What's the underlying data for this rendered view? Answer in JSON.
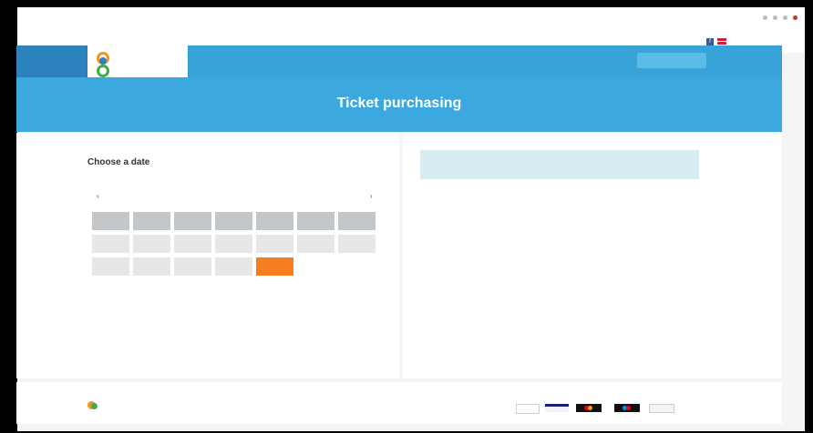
{
  "header": {
    "nav_links": [
      "",
      "",
      "",
      ""
    ],
    "cta_label": ""
  },
  "colors": {
    "accent": "#37a3d9",
    "accent_dark": "#2b82bd",
    "selected_date": "#f57f1f",
    "notice_bg": "#d6eef3"
  },
  "hero": {
    "title": "Ticket purchasing"
  },
  "calendar": {
    "heading": "Choose a date",
    "prev_icon": "‹",
    "next_icon": "›",
    "weekday_headers": [
      "",
      "",
      "",
      "",
      "",
      "",
      ""
    ],
    "days": [
      {
        "label": "",
        "state": "disabled"
      },
      {
        "label": "",
        "state": "disabled"
      },
      {
        "label": "",
        "state": "disabled"
      },
      {
        "label": "",
        "state": "disabled"
      },
      {
        "label": "",
        "state": "disabled"
      },
      {
        "label": "",
        "state": "disabled"
      },
      {
        "label": "",
        "state": "disabled"
      },
      {
        "label": "",
        "state": "disabled"
      },
      {
        "label": "",
        "state": "disabled"
      },
      {
        "label": "",
        "state": "disabled"
      },
      {
        "label": "",
        "state": "disabled"
      },
      {
        "label": "",
        "state": "selected"
      },
      {
        "label": "",
        "state": "available"
      },
      {
        "label": "",
        "state": "available"
      },
      {
        "label": "",
        "state": "available"
      },
      {
        "label": "",
        "state": "available"
      },
      {
        "label": "",
        "state": "available"
      },
      {
        "label": "",
        "state": "available"
      },
      {
        "label": "",
        "state": "available"
      },
      {
        "label": "",
        "state": "available"
      },
      {
        "label": "",
        "state": "available"
      },
      {
        "label": "",
        "state": "available"
      },
      {
        "label": "",
        "state": "available"
      },
      {
        "label": "",
        "state": "available"
      },
      {
        "label": "",
        "state": "available"
      },
      {
        "label": "",
        "state": "available"
      },
      {
        "label": "",
        "state": "available"
      },
      {
        "label": "",
        "state": "available"
      },
      {
        "label": "",
        "state": "available"
      },
      {
        "label": "",
        "state": "available"
      },
      {
        "label": "",
        "state": "available"
      },
      {
        "label": "",
        "state": "available"
      },
      {
        "label": "",
        "state": "available"
      },
      {
        "label": "",
        "state": "available"
      },
      {
        "label": "",
        "state": "available"
      }
    ]
  },
  "icons": [
    "facebook-icon",
    "uk-flag-icon",
    "logo-icon",
    "chevron-left-icon",
    "chevron-right-icon",
    "visa-icon",
    "paypal-icon",
    "mastercard-icon",
    "maestro-icon",
    "amex-icon"
  ]
}
